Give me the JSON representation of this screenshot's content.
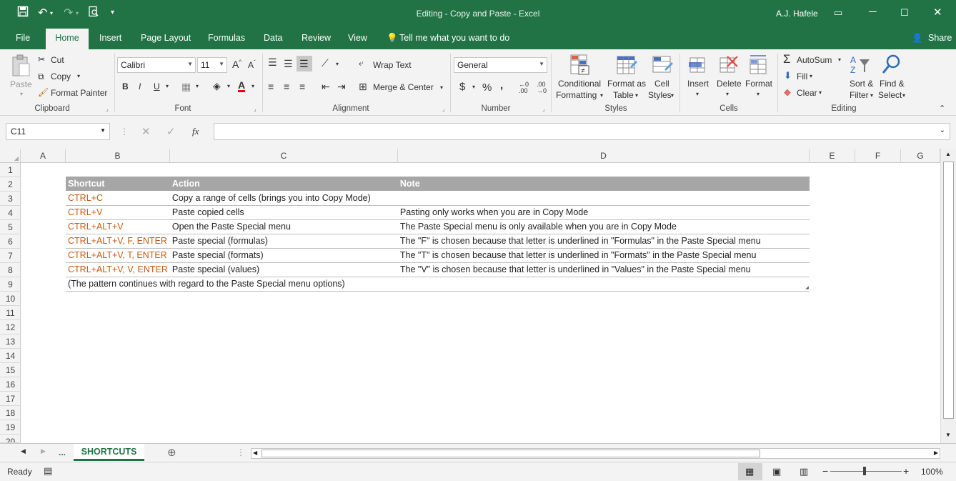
{
  "titlebar": {
    "title": "Editing - Copy and Paste  -  Excel",
    "user": "A.J. Hafele",
    "icons": [
      "save-icon",
      "undo-icon",
      "redo-icon",
      "print-preview-icon",
      "customize-qat-icon"
    ],
    "window_controls": [
      "ribbon-display-icon",
      "minimize-icon",
      "restore-icon",
      "close-icon"
    ]
  },
  "tabs": {
    "file": "File",
    "home": "Home",
    "insert": "Insert",
    "page_layout": "Page Layout",
    "formulas": "Formulas",
    "data": "Data",
    "review": "Review",
    "view": "View",
    "tell_me": "Tell me what you want to do",
    "share": "Share"
  },
  "ribbon": {
    "clipboard": {
      "label": "Clipboard",
      "paste": "Paste",
      "cut": "Cut",
      "copy": "Copy",
      "format_painter": "Format Painter"
    },
    "font": {
      "label": "Font",
      "font_name": "Calibri",
      "font_size": "11",
      "bold": "B",
      "italic": "I",
      "underline": "U"
    },
    "alignment": {
      "label": "Alignment",
      "wrap_text": "Wrap Text",
      "merge_center": "Merge & Center"
    },
    "number": {
      "label": "Number",
      "format": "General",
      "currency": "$",
      "percent": "%",
      "comma": ","
    },
    "styles": {
      "label": "Styles",
      "conditional_1": "Conditional",
      "conditional_2": "Formatting",
      "format_as_1": "Format as",
      "format_as_2": "Table",
      "cell_styles_1": "Cell",
      "cell_styles_2": "Styles"
    },
    "cells": {
      "label": "Cells",
      "insert": "Insert",
      "delete": "Delete",
      "format": "Format"
    },
    "editing": {
      "label": "Editing",
      "autosum": "AutoSum",
      "fill": "Fill",
      "clear": "Clear",
      "sort_1": "Sort &",
      "sort_2": "Filter",
      "find_1": "Find &",
      "find_2": "Select"
    }
  },
  "formula_bar": {
    "name_box": "C11",
    "fx": "fx",
    "formula": ""
  },
  "columns": [
    "A",
    "B",
    "C",
    "D",
    "E",
    "F",
    "G"
  ],
  "rows": [
    "1",
    "2",
    "3",
    "4",
    "5",
    "6",
    "7",
    "8",
    "9",
    "10",
    "11",
    "12",
    "13",
    "14",
    "15",
    "16",
    "17",
    "18",
    "19",
    "20"
  ],
  "table": {
    "headers": [
      "Shortcut",
      "Action",
      "Note"
    ],
    "rows": [
      [
        "CTRL+C",
        "Copy a range of cells (brings you into Copy Mode)",
        ""
      ],
      [
        "CTRL+V",
        "Paste copied cells",
        "Pasting only works when you are in Copy Mode"
      ],
      [
        "CTRL+ALT+V",
        "Open the Paste Special menu",
        "The Paste Special menu is only available when you are in Copy Mode"
      ],
      [
        "CTRL+ALT+V, F, ENTER",
        "Paste special (formulas)",
        "The \"F\" is chosen because that letter is underlined in \"Formulas\" in the Paste Special menu"
      ],
      [
        "CTRL+ALT+V, T, ENTER",
        "Paste special (formats)",
        "The \"T\" is chosen because that letter is underlined in \"Formats\" in the Paste Special menu"
      ],
      [
        "CTRL+ALT+V, V, ENTER",
        "Paste special (values)",
        "The \"V\" is chosen because that letter is underlined in \"Values\" in the Paste Special menu"
      ]
    ],
    "footer": "(The pattern continues with regard to the Paste Special menu options)"
  },
  "sheet_tabs": {
    "more": "...",
    "active": "SHORTCUTS"
  },
  "status": {
    "ready": "Ready",
    "zoom": "100%"
  },
  "colors": {
    "brand": "#217346",
    "shortcut_text": "#c65911",
    "header_fill": "#a6a6a6"
  }
}
